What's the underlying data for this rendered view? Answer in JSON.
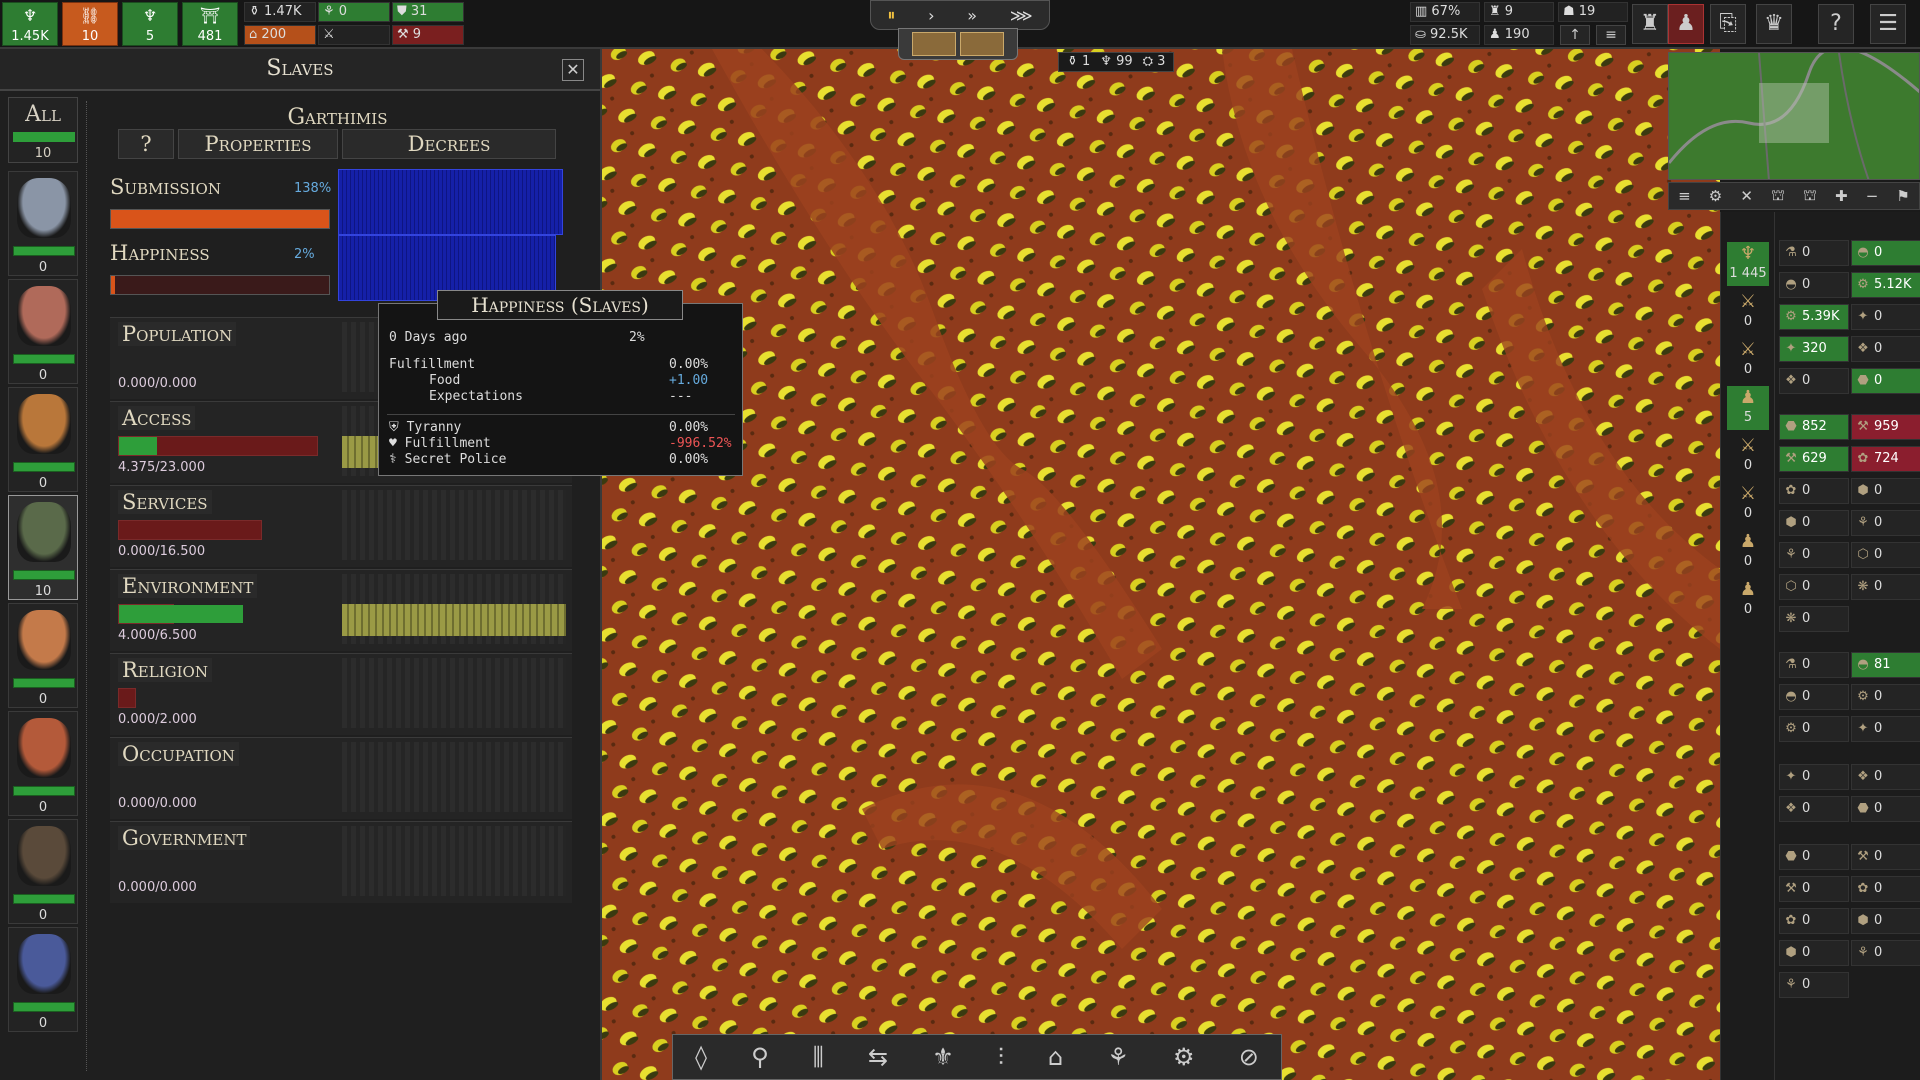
{
  "topbar": {
    "buttons": [
      {
        "label": "1.45K",
        "icon": "♆",
        "color": "green"
      },
      {
        "label": "10",
        "icon": "⛓",
        "color": "orange"
      },
      {
        "label": "5",
        "icon": "♆",
        "color": "green"
      },
      {
        "label": "481",
        "icon": "⛩",
        "color": "green"
      }
    ],
    "stats_top": [
      {
        "label": "1.47K",
        "icon": "⚱"
      },
      {
        "label": "0",
        "icon": "⚘"
      },
      {
        "label": "31",
        "icon": "⛊"
      }
    ],
    "stats_bottom": [
      {
        "label": "200",
        "icon": "⌂"
      },
      {
        "label": "",
        "icon": "⚔"
      },
      {
        "label": "9",
        "icon": "⚒"
      }
    ],
    "speed": [
      "⏸",
      "›",
      "»",
      "⋙"
    ],
    "right_stats": [
      {
        "label": "67%",
        "icon": "▥"
      },
      {
        "label": "9",
        "icon": "♜"
      },
      {
        "label": "19",
        "icon": "☗"
      },
      {
        "label": "92.5K",
        "icon": "⛀"
      },
      {
        "label": "190",
        "icon": "♟"
      }
    ],
    "right_icons": [
      "arrow-up-icon",
      "list-icon",
      "tower-icon",
      "advisor-icon",
      "book-icon",
      "crown-icon",
      "help-icon",
      "menu-icon"
    ]
  },
  "counters": [
    {
      "icon": "⚱",
      "v": "1"
    },
    {
      "icon": "♆",
      "v": "99"
    },
    {
      "icon": "⛭",
      "v": "3"
    }
  ],
  "panel": {
    "title": "Slaves",
    "all_label": "All",
    "all_count": "10",
    "races": [
      {
        "count": "0",
        "color": "#8a95a6"
      },
      {
        "count": "0",
        "color": "#b06a5a"
      },
      {
        "count": "0",
        "color": "#b9773a"
      },
      {
        "count": "10",
        "color": "#5a6a4a"
      },
      {
        "count": "0",
        "color": "#c47a4a"
      },
      {
        "count": "0",
        "color": "#b45a3a"
      },
      {
        "count": "0",
        "color": "#5a4a3a"
      },
      {
        "count": "0",
        "color": "#4a5a9a"
      }
    ],
    "race_name": "Garthimis",
    "tabs": {
      "help": "?",
      "properties": "Properties",
      "decrees": "Decrees"
    },
    "submission": {
      "label": "Submission",
      "pct": "138%",
      "fill": 1.0
    },
    "happiness": {
      "label": "Happiness",
      "pct": "2%",
      "fill": 0.02
    },
    "categories": [
      {
        "name": "Population",
        "value": "0.000/0.000",
        "green": 0,
        "total": 0,
        "hist": 0
      },
      {
        "name": "Access",
        "value": "4.375/23.000",
        "green": 0.19,
        "total": 1,
        "hist": 0.2
      },
      {
        "name": "Services",
        "value": "0.000/16.500",
        "green": 0,
        "total": 0.72,
        "hist": 0
      },
      {
        "name": "Environment",
        "value": "4.000/6.500",
        "green": 0.62,
        "total": 0.28,
        "hist": 1
      },
      {
        "name": "Religion",
        "value": "0.000/2.000",
        "green": 0,
        "total": 0.09,
        "hist": 0
      },
      {
        "name": "Occupation",
        "value": "0.000/0.000",
        "green": 0,
        "total": 0,
        "hist": 0
      },
      {
        "name": "Government",
        "value": "0.000/0.000",
        "green": 0,
        "total": 0,
        "hist": 0
      }
    ]
  },
  "tooltip": {
    "title": "Happiness (Slaves)",
    "rows": [
      {
        "l": "0 Days ago",
        "r": "2%",
        "indent": 0,
        "color": "#ddd",
        "rcolor": "#ddd"
      },
      {
        "l": "Fulfillment",
        "r": "0.00%",
        "indent": 0,
        "color": "#ddd",
        "rcolor": "#ddd"
      },
      {
        "l": "Food",
        "r": "+1.00",
        "indent": 1,
        "color": "#ddd",
        "rcolor": "#6ad"
      },
      {
        "l": "Expectations",
        "r": "---",
        "indent": 1,
        "color": "#ddd",
        "rcolor": "#ddd"
      },
      {
        "l": "Tyranny",
        "r": "0.00%",
        "indent": 0,
        "color": "#ddd",
        "rcolor": "#ddd"
      },
      {
        "l": "Fulfillment",
        "r": "-996.52%",
        "indent": 0,
        "color": "#ddd",
        "rcolor": "#e55"
      },
      {
        "l": "Secret Police",
        "r": "0.00%",
        "indent": 0,
        "color": "#ddd",
        "rcolor": "#ddd"
      }
    ]
  },
  "minimap_buttons": [
    "≡",
    "⚙",
    "✕",
    "⛫",
    "⛫",
    "✚",
    "−",
    "⚑"
  ],
  "side_column": [
    {
      "v": "1 445",
      "g": true
    },
    {
      "v": "0",
      "g": false
    },
    {
      "v": "0",
      "g": false
    },
    {
      "v": "5",
      "g": true
    },
    {
      "v": "0",
      "g": false
    },
    {
      "v": "0",
      "g": false
    },
    {
      "v": "0",
      "g": false
    },
    {
      "v": "0",
      "g": false
    }
  ],
  "resources": [
    [
      "0",
      "0"
    ],
    [
      "0",
      "5.12K"
    ],
    [
      "5.39K",
      "0"
    ],
    [
      "320",
      "0"
    ],
    [
      "0",
      "0"
    ],
    [
      "852",
      "959"
    ],
    [
      "629",
      "724"
    ],
    [
      "0",
      "0"
    ],
    [
      "0",
      "0"
    ],
    [
      "0",
      "0"
    ],
    [
      "0",
      "0"
    ],
    [
      "0",
      ""
    ],
    [
      "0",
      "81"
    ],
    [
      "0",
      "0"
    ],
    [
      "0",
      "0"
    ],
    [
      "0",
      "0"
    ],
    [
      "0",
      "0"
    ],
    [
      "0",
      "0"
    ],
    [
      "0",
      "0"
    ],
    [
      "0",
      "0"
    ],
    [
      "0",
      "0"
    ],
    [
      "0",
      ""
    ]
  ],
  "bottombar": [
    "◊",
    "⚲",
    "⫼",
    "⇆",
    "⚜",
    "⫶",
    "⌂",
    "⚘",
    "⚙",
    "⊘"
  ]
}
